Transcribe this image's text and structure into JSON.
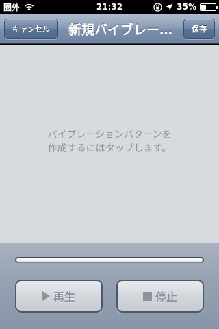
{
  "status_bar": {
    "carrier": "圏外",
    "time": "21:32",
    "battery": "35%",
    "battery_level": 0.35,
    "icons": [
      "wifi-icon",
      "lock-rotation-icon",
      "location-icon",
      "battery-icon"
    ]
  },
  "nav": {
    "cancel_label": "キャンセル",
    "title": "新規バイブレー…",
    "save_label": "保存"
  },
  "content": {
    "prompt_line1": "バイブレーションパターンを",
    "prompt_line2": "作成するにはタップします。"
  },
  "controls": {
    "progress": 1.0,
    "play_label": "再生",
    "play_icon": "play-icon",
    "stop_label": "停止",
    "stop_icon": "stop-icon"
  },
  "colors": {
    "navbar": "#7d90aa",
    "content_bg": "#d7dadf",
    "disabled_text": "#8c939c"
  }
}
